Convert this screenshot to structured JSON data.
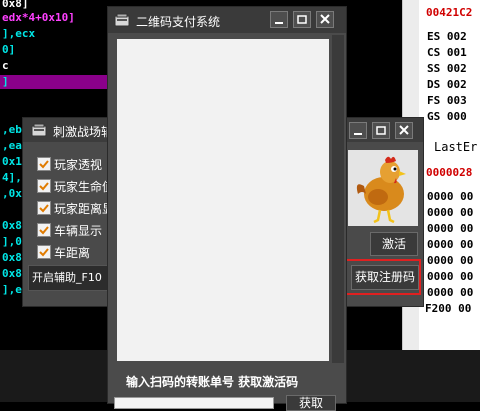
{
  "debugger": {
    "asm_lines": [
      "0x8]",
      "edx*4+0x10]",
      "],ecx",
      "0]",
      "c",
      "]",
      ",eb",
      ",ea",
      "0x1",
      "4],",
      ",0x",
      "0x8",
      "],0",
      "0x8",
      "0x8",
      "],e"
    ],
    "registers": {
      "address": "00421C2",
      "seg_lines": [
        "ES 002",
        "CS 001",
        "SS 002",
        "DS 002",
        "FS 003",
        "GS 000"
      ],
      "last_error": "LastEr",
      "red_value": "0000028",
      "mem_lines": [
        "0000 00",
        "0000 00",
        "0000 00",
        "0000 00",
        "0000 00",
        "0000 00",
        "0000 00",
        "F200 00"
      ]
    }
  },
  "cheat_window": {
    "title": "刺激战场辅助",
    "options": [
      {
        "label": "玩家透视",
        "checked": true
      },
      {
        "label": "玩家生命值",
        "checked": true
      },
      {
        "label": "玩家距离显示",
        "checked": true
      },
      {
        "label": "车辆显示",
        "checked": true
      },
      {
        "label": "车距离",
        "checked": true
      }
    ],
    "hotkey_text": "开启辅助_F10",
    "activate_button": "激活",
    "get_code_button": "获取注册码"
  },
  "qr_window": {
    "title": "二维码支付系统",
    "instruction": "输入扫码的转账单号 获取激活码",
    "submit_button": "获取"
  },
  "colors": {
    "highlight": "#8a008a",
    "asm_text": "#00e6e6",
    "red_outline": "#e02020"
  }
}
